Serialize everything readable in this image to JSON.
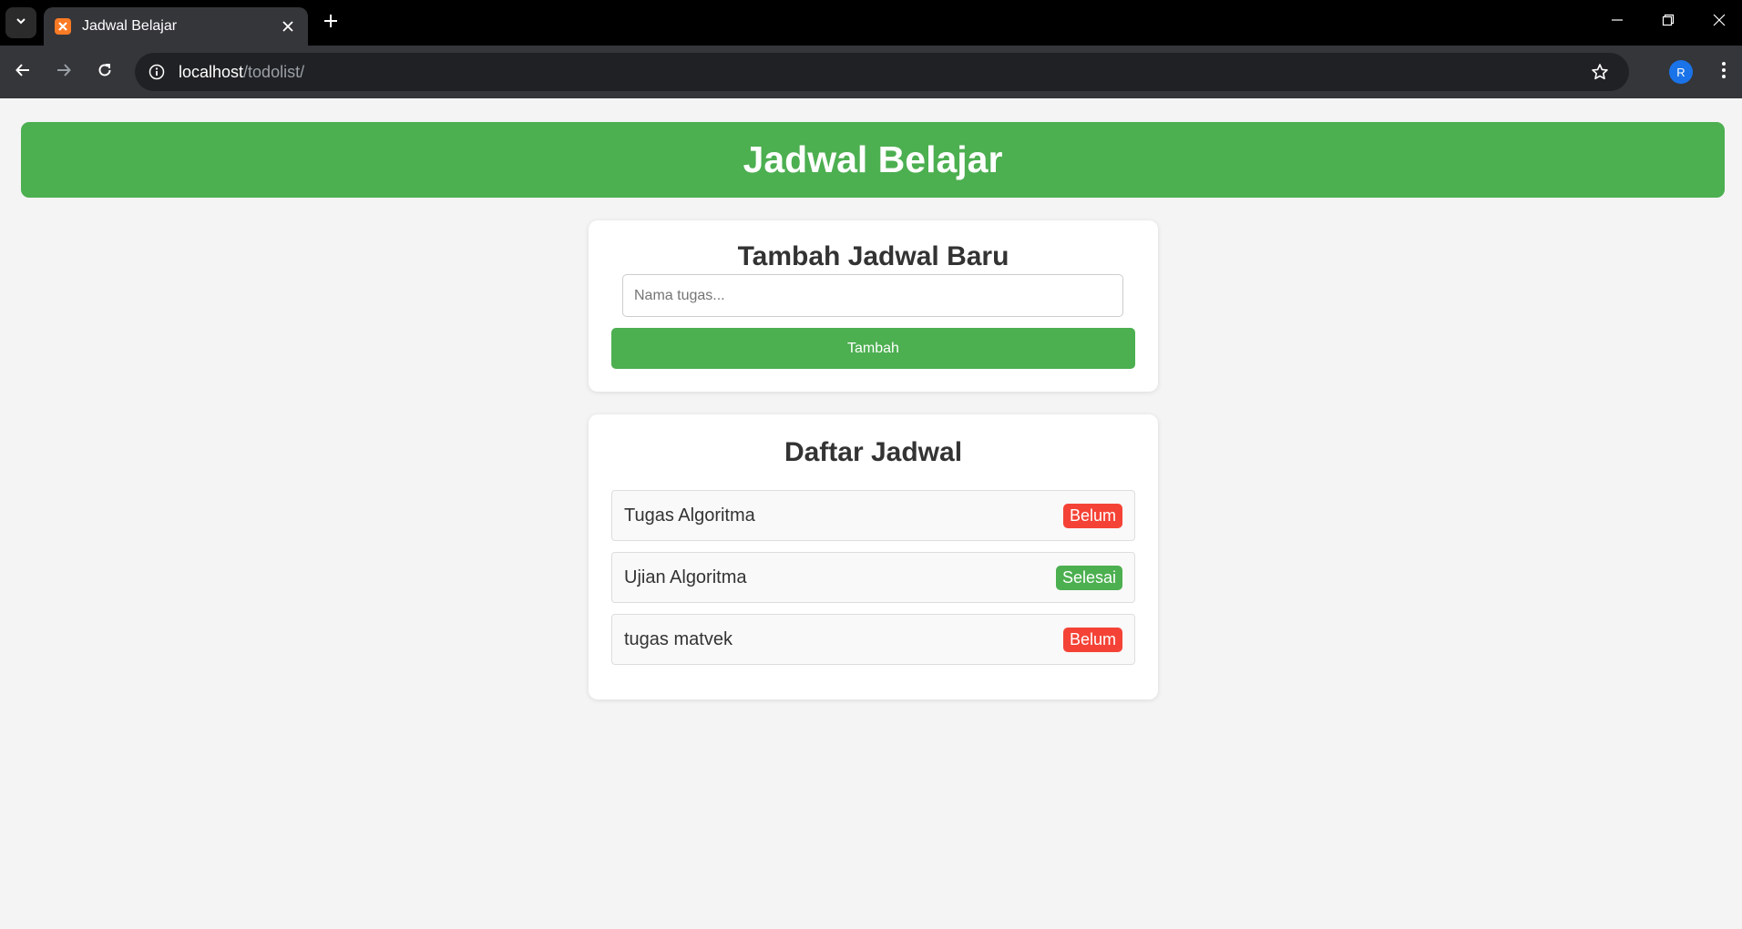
{
  "browser": {
    "tab_title": "Jadwal Belajar",
    "url_host": "localhost",
    "url_path": "/todolist/",
    "avatar_initial": "R"
  },
  "header": {
    "title": "Jadwal Belajar",
    "color": "#4caf50"
  },
  "add_form": {
    "heading": "Tambah Jadwal Baru",
    "input_placeholder": "Nama tugas...",
    "input_value": "",
    "button_label": "Tambah"
  },
  "list": {
    "heading": "Daftar Jadwal",
    "items": [
      {
        "name": "Tugas Algoritma",
        "status": "Belum",
        "status_color": "#f44336"
      },
      {
        "name": "Ujian Algoritma",
        "status": "Selesai",
        "status_color": "#4caf50"
      },
      {
        "name": "tugas matvek",
        "status": "Belum",
        "status_color": "#f44336"
      }
    ]
  },
  "icons": {
    "tab_search": "chevron-down-icon",
    "favicon": "xampp-icon",
    "tab_close": "close-icon",
    "new_tab": "plus-icon",
    "back": "arrow-left-icon",
    "forward": "arrow-right-icon",
    "reload": "reload-icon",
    "site_info": "info-icon",
    "bookmark": "star-icon",
    "menu": "more-vert-icon",
    "minimize": "minimize-icon",
    "restore": "restore-icon",
    "window_close": "close-icon"
  }
}
